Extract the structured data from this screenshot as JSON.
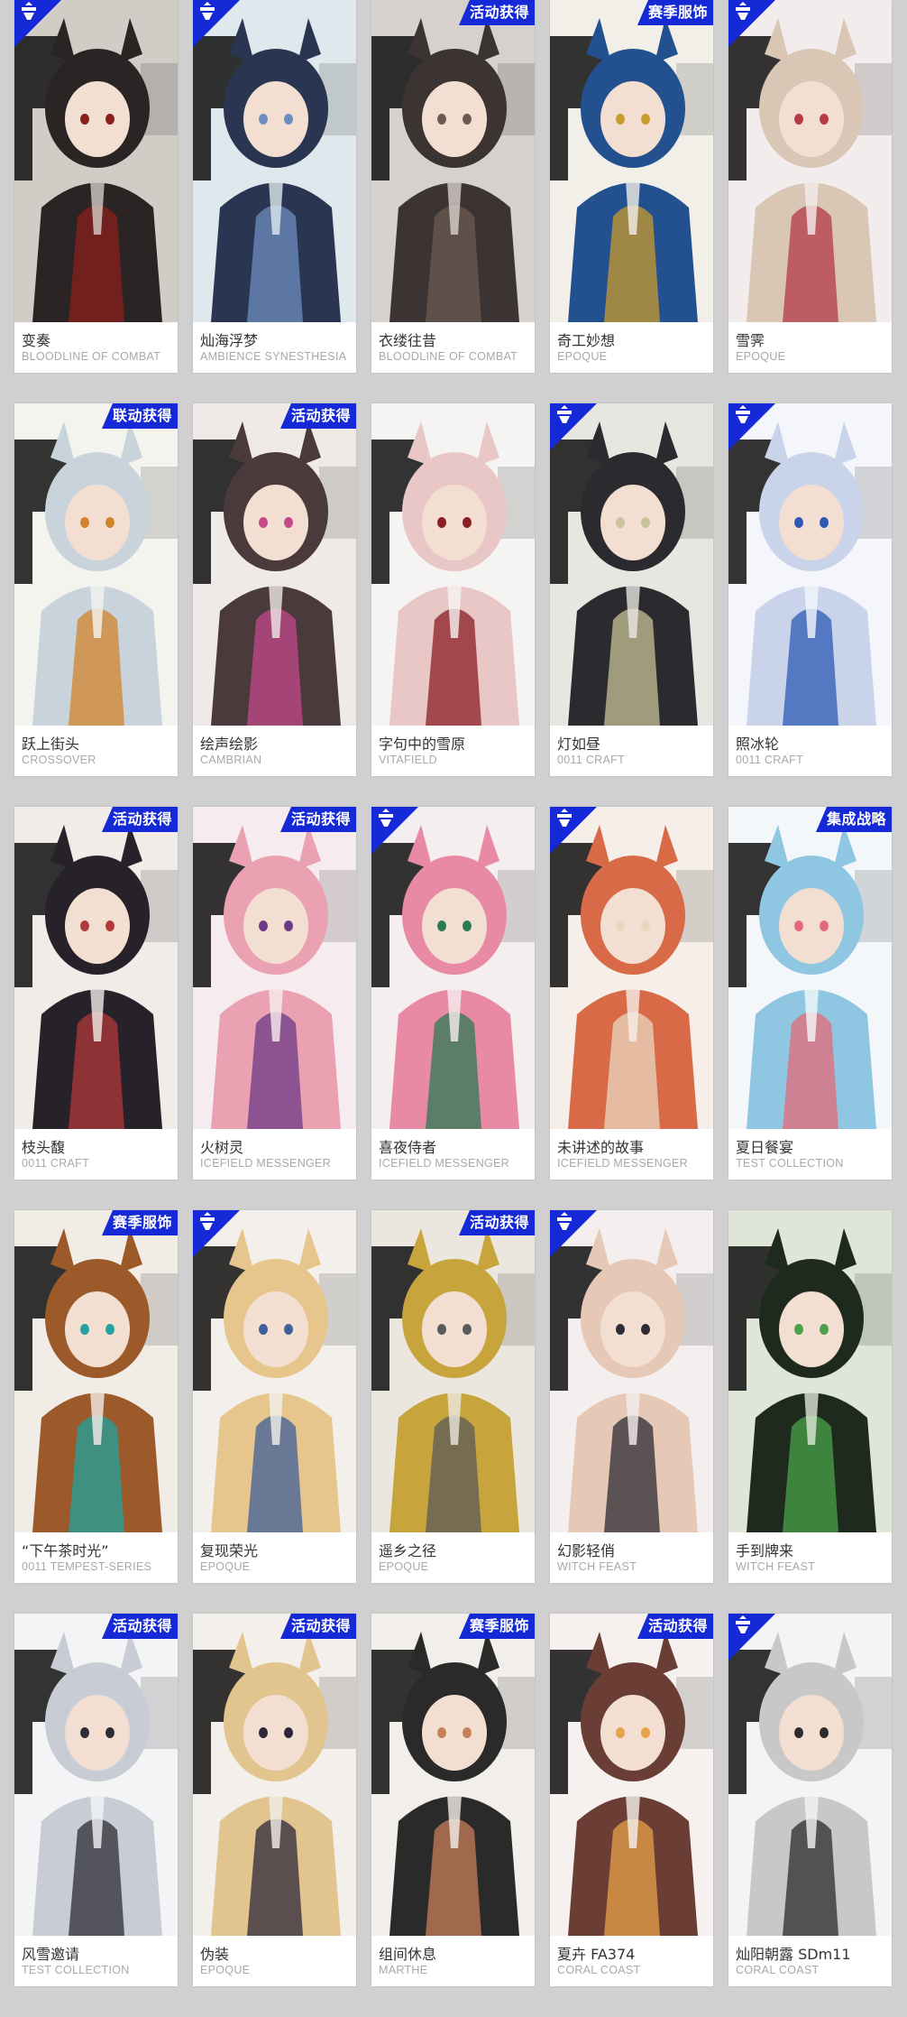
{
  "cards": [
    {
      "name": "变奏",
      "series": "BLOODLINE OF COMBAT",
      "badge": "",
      "corner": true,
      "palette": [
        "#2b2424",
        "#d2ccc6",
        "#8a1f1c"
      ]
    },
    {
      "name": "灿海浮梦",
      "series": "AMBIENCE SYNESTHESIA",
      "badge": "",
      "corner": true,
      "palette": [
        "#2a3552",
        "#dfe8ec",
        "#6e8dbf"
      ]
    },
    {
      "name": "衣缕往昔",
      "series": "BLOODLINE OF COMBAT",
      "badge": "活动获得",
      "corner": false,
      "palette": [
        "#3c3432",
        "#d7d1cd",
        "#6b5a52"
      ]
    },
    {
      "name": "奇工妙想",
      "series": "EPOQUE",
      "badge": "赛季服饰",
      "corner": false,
      "palette": [
        "#23508e",
        "#f1efe8",
        "#c99a2e"
      ]
    },
    {
      "name": "雪霁",
      "series": "EPOQUE",
      "badge": "",
      "corner": true,
      "palette": [
        "#d9c6b4",
        "#f3ecec",
        "#b43a46"
      ]
    },
    {
      "name": "跃上街头",
      "series": "CROSSOVER",
      "badge": "联动获得",
      "corner": false,
      "palette": [
        "#c9d3dc",
        "#f4f4ef",
        "#d0842e"
      ]
    },
    {
      "name": "绘声绘影",
      "series": "CAMBRIAN",
      "badge": "活动获得",
      "corner": false,
      "palette": [
        "#4a3a3c",
        "#efeae7",
        "#c4488a"
      ]
    },
    {
      "name": "字句中的雪原",
      "series": "VITAFIELD",
      "badge": "",
      "corner": false,
      "palette": [
        "#e9c7c6",
        "#f6f3f3",
        "#8a1e24"
      ]
    },
    {
      "name": "灯如昼",
      "series": "0011 CRAFT",
      "badge": "",
      "corner": true,
      "palette": [
        "#2b2b2f",
        "#e8e6e0",
        "#c9c29a"
      ]
    },
    {
      "name": "照冰轮",
      "series": "0011 CRAFT",
      "badge": "",
      "corner": true,
      "palette": [
        "#c9d3ea",
        "#f4f6fb",
        "#2d59b5"
      ]
    },
    {
      "name": "枝头馥",
      "series": "0011 CRAFT",
      "badge": "活动获得",
      "corner": false,
      "palette": [
        "#27222a",
        "#f1ece8",
        "#b03a3a"
      ]
    },
    {
      "name": "火树灵",
      "series": "ICEFIELD MESSENGER",
      "badge": "活动获得",
      "corner": false,
      "palette": [
        "#eaa1b2",
        "#f6ecef",
        "#6c3a84"
      ]
    },
    {
      "name": "喜夜侍者",
      "series": "ICEFIELD MESSENGER",
      "badge": "",
      "corner": true,
      "palette": [
        "#e88aa4",
        "#f5eef0",
        "#2e7a55"
      ]
    },
    {
      "name": "未讲述的故事",
      "series": "ICEFIELD MESSENGER",
      "badge": "",
      "corner": true,
      "palette": [
        "#d96a48",
        "#f6efe9",
        "#e8d7bf"
      ]
    },
    {
      "name": "夏日餐宴",
      "series": "TEST COLLECTION",
      "badge": "集成战略",
      "corner": false,
      "palette": [
        "#8fc7e2",
        "#f3f7f9",
        "#e46a7a"
      ]
    },
    {
      "name": "“下午茶时光”",
      "series": "0011 TEMPEST-SERIES",
      "badge": "赛季服饰",
      "corner": false,
      "palette": [
        "#9c5a2b",
        "#f1ece6",
        "#22a3a0"
      ]
    },
    {
      "name": "复现荣光",
      "series": "EPOQUE",
      "badge": "",
      "corner": true,
      "palette": [
        "#e6c68d",
        "#f3f0eb",
        "#3f5f98"
      ]
    },
    {
      "name": "遥乡之径",
      "series": "EPOQUE",
      "badge": "活动获得",
      "corner": false,
      "palette": [
        "#c7a53c",
        "#ece7de",
        "#5a5a5a"
      ]
    },
    {
      "name": "幻影轻俏",
      "series": "WITCH FEAST",
      "badge": "",
      "corner": true,
      "palette": [
        "#e6c8b6",
        "#f4efee",
        "#2d2b33"
      ]
    },
    {
      "name": "手到牌来",
      "series": "WITCH FEAST",
      "badge": "",
      "corner": false,
      "palette": [
        "#1f2a1f",
        "#dfe6d8",
        "#4aa14a"
      ]
    },
    {
      "name": "风雪邀请",
      "series": "TEST COLLECTION",
      "badge": "活动获得",
      "corner": false,
      "palette": [
        "#c8ccd4",
        "#f4f4f6",
        "#2c2c34"
      ]
    },
    {
      "name": "伪装",
      "series": "EPOQUE",
      "badge": "活动获得",
      "corner": false,
      "palette": [
        "#e2c48f",
        "#f3efea",
        "#2d2738"
      ]
    },
    {
      "name": "组间休息",
      "series": "MARTHE",
      "badge": "赛季服饰",
      "corner": false,
      "palette": [
        "#2a2a2a",
        "#f2efea",
        "#c87f5a"
      ]
    },
    {
      "name": "夏卉 FA374",
      "series": "CORAL COAST",
      "badge": "活动获得",
      "corner": false,
      "palette": [
        "#6a3e35",
        "#f6f1ee",
        "#e8a24a"
      ]
    },
    {
      "name": "灿阳朝露 SDm11",
      "series": "CORAL COAST",
      "badge": "",
      "corner": true,
      "palette": [
        "#c8c8c8",
        "#f4f4f4",
        "#2b2b2b"
      ]
    }
  ],
  "colors": {
    "badge_bg": "#1529d6",
    "page_bg": "#d0d0d0",
    "series_text": "#a8a8a8"
  },
  "icons": {
    "corner": "rhodes-island-logo-icon",
    "art": "character-portrait"
  }
}
